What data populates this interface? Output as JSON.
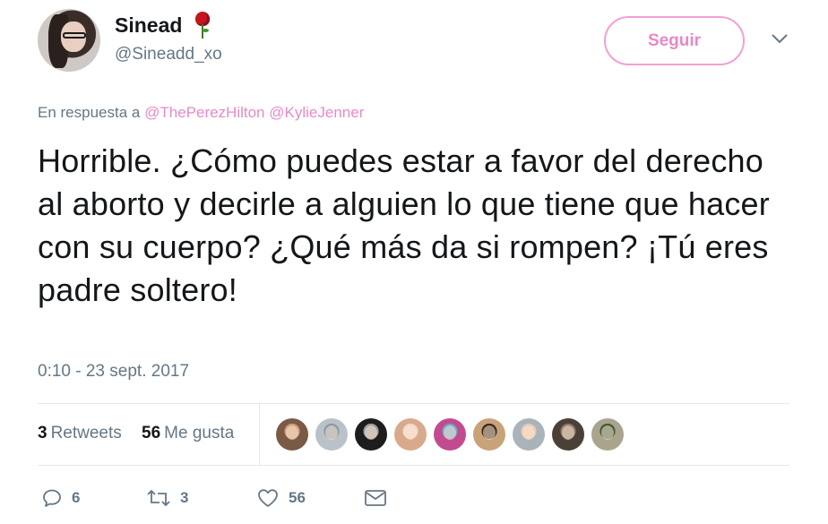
{
  "user": {
    "display_name": "Sinead",
    "handle": "@Sineadd_xo",
    "name_emoji_icon": "rose-icon"
  },
  "follow_button": {
    "label": "Seguir",
    "color": "#e889c6",
    "border": "#f2a0d4"
  },
  "reply": {
    "prefix": "En respuesta a",
    "mentions": [
      "@ThePerezHilton",
      "@KylieJenner"
    ]
  },
  "tweet": {
    "text": "Horrible. ¿Cómo puedes estar a favor del derecho al aborto y decirle a alguien lo que tiene que hacer con su cuerpo? ¿Qué más da si rompen? ¡Tú eres padre soltero!",
    "timestamp": "0:10 - 23 sept. 2017"
  },
  "stats": {
    "retweets_count": "3",
    "retweets_label": "Retweets",
    "likes_count": "56",
    "likes_label": "Me gusta"
  },
  "liker_avatars": [
    {
      "bg": "#7a5a45",
      "accent": "#c9a07c"
    },
    {
      "bg": "#b9c2c9",
      "accent": "#8a99a6"
    },
    {
      "bg": "#1d1d1d",
      "accent": "#9b9b9b"
    },
    {
      "bg": "#d9a98c",
      "accent": "#f0d8c8"
    },
    {
      "bg": "#c24b8f",
      "accent": "#6fa6c8"
    },
    {
      "bg": "#c8a37a",
      "accent": "#3b2a20"
    },
    {
      "bg": "#a9b3b9",
      "accent": "#e7c9b3"
    },
    {
      "bg": "#4a4038",
      "accent": "#8d7b6a"
    },
    {
      "bg": "#a9a48e",
      "accent": "#3e5a3a"
    }
  ],
  "actions": {
    "reply_count": "6",
    "retweet_count": "3",
    "like_count": "56",
    "reply_icon": "reply-bubble-icon",
    "retweet_icon": "retweet-icon",
    "like_icon": "heart-icon",
    "dm_icon": "envelope-icon"
  },
  "colors": {
    "accent_pink": "#e889c6",
    "text_primary": "#14171a",
    "text_secondary": "#657786",
    "divider": "#e1e8ed"
  }
}
